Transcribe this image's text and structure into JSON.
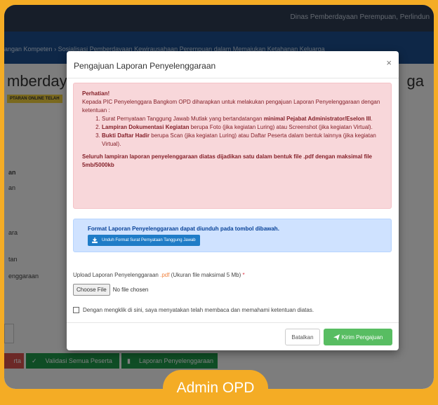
{
  "header": {
    "org": "Dinas Pemberdayaan Perempuan, Perlindun"
  },
  "breadcrumb": {
    "left": "angan Kompeten",
    "right": "Sosialisasi Pemberdayaan Kewirausahaan Perempuan dalam Memajukan Ketahanan Keluarga"
  },
  "background": {
    "heading_left": "mberdayaa",
    "heading_right": "ga",
    "badge": "PTARAN ONLINE TELAH",
    "labels": [
      "an",
      "an",
      "ara",
      "tan",
      "enggaraan"
    ],
    "btn_partial": "rta",
    "btn_validate": "Validasi Semua Peserta",
    "btn_report": "Laporan Penyelenggaraan"
  },
  "modal": {
    "title": "Pengajuan Laporan Penyelenggaraan",
    "close": "×",
    "alert": {
      "heading": "Perhatian!",
      "intro": "Kepada PIC Penyelenggara Bangkom OPD diharapkan untuk melakukan pengajuan Laporan Penyelenggaraan dengan ketentuan :",
      "item1_text": "Surat Pernyataan Tanggung Jawab Mutlak yang bertandatangan ",
      "item1_bold": "minimal Pejabat Administrator/Eselon III",
      "item2_bold": "Lampiran Dokumentasi Kegiatan",
      "item2_text": " berupa Foto (jika kegiatan Luring) atau Screenshot (jika kegiatan Virtual).",
      "item3_bold": "Bukti Daftar Hadir",
      "item3_text": " berupa Scan (jika kegiatan Luring) atau Daftar Peserta dalam bentuk lainnya (jika kegiatan Virtual).",
      "footer": "Seluruh lampiran laporan penyelenggaraan diatas dijadikan satu dalam bentuk file .pdf dengan maksimal file 5mb/5000kb"
    },
    "info": {
      "text": "Format Laporan Penyelenggaraan dapat diunduh pada tombol dibawah.",
      "download_label": "Unduh Format Surat Pernyataan Tanggung Jawab"
    },
    "upload": {
      "label": "Upload Laporan Penyelenggaraan ",
      "ext": ".pdf",
      "hint": " (Ukuran file maksimal 5 Mb) ",
      "req": "*",
      "choose": "Choose File",
      "nofile": "No file chosen"
    },
    "agree": "Dengan mengklik di sini, saya menyatakan telah membaca dan memahami ketentuan diatas.",
    "cancel": "Batalkan",
    "submit": "Kirim Pengajuan"
  },
  "footer_pill": "Admin OPD",
  "colors": {
    "accent": "#f4ac25",
    "danger_bg": "#f8d7da",
    "info_bg": "#cfe2ff",
    "success": "#58bd62",
    "primary": "#1f7cc7"
  }
}
